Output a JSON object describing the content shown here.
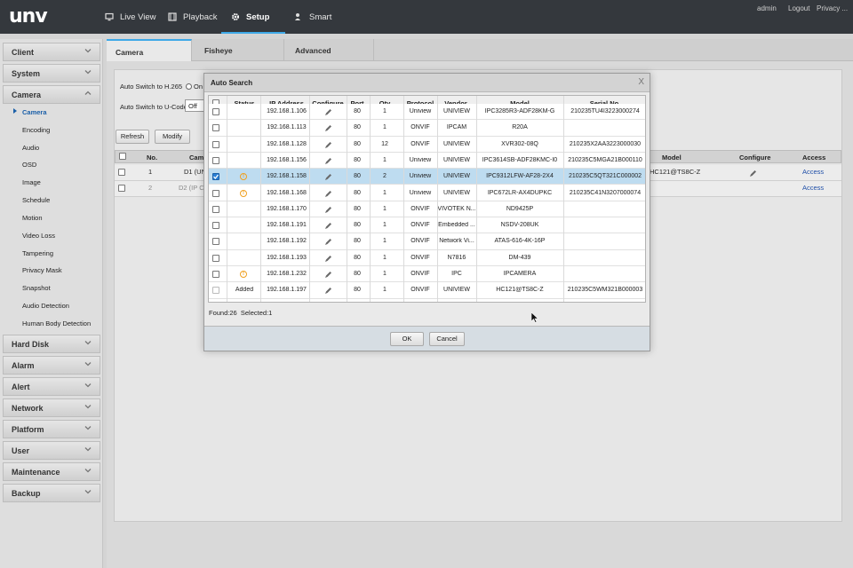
{
  "app": {
    "logo": "unv",
    "nav": [
      "Live View",
      "Playback",
      "Setup",
      "Smart"
    ],
    "user": "admin",
    "logout": "Logout",
    "privacy": "Privacy ..."
  },
  "sidebar": {
    "sections": [
      "Client",
      "System",
      "Camera",
      "Hard Disk",
      "Alarm",
      "Alert",
      "Network",
      "Platform",
      "User",
      "Maintenance",
      "Backup"
    ],
    "camera_items": [
      "Camera",
      "Encoding",
      "Audio",
      "OSD",
      "Image",
      "Schedule",
      "Motion",
      "Video Loss",
      "Tampering",
      "Privacy Mask",
      "Snapshot",
      "Audio Detection",
      "Human Body Detection"
    ]
  },
  "tabs": [
    "Camera",
    "Fisheye",
    "Advanced"
  ],
  "panel": {
    "h265_label": "Auto Switch to H.265",
    "h265_on": "On",
    "ucode_label": "Auto Switch to U-Code",
    "ucode_value": "Off",
    "refresh": "Refresh",
    "modify": "Modify",
    "table_headers": {
      "no": "No.",
      "camera": "Came",
      "model": "Model",
      "configure": "Configure",
      "access": "Access"
    },
    "rows": [
      {
        "no": "1",
        "camera": "D1 (UN",
        "model": "HC121@TS8C-Z",
        "access": "Access"
      },
      {
        "no": "2",
        "camera": "D2 (IP Ca",
        "model": "",
        "access": "Access"
      }
    ]
  },
  "modal": {
    "title": "Auto Search",
    "close": "X",
    "headers": [
      "Status",
      "IP Address",
      "Configure",
      "Port",
      "Qty",
      "Protocol",
      "Vendor",
      "Model",
      "Serial No."
    ],
    "rows": [
      {
        "status": "",
        "ip": "192.168.1.106",
        "port": "80",
        "qty": "1",
        "protocol": "Uniview",
        "vendor": "UNIVIEW",
        "model": "IPC3285R3-ADF28KM-G",
        "serial": "210235TU4I3223000274"
      },
      {
        "status": "",
        "ip": "192.168.1.113",
        "port": "80",
        "qty": "1",
        "protocol": "ONVIF",
        "vendor": "IPCAM",
        "model": "R20A",
        "serial": ""
      },
      {
        "status": "",
        "ip": "192.168.1.128",
        "port": "80",
        "qty": "12",
        "protocol": "ONVIF",
        "vendor": "UNIVIEW",
        "model": "XVR302-08Q",
        "serial": "210235X2AA3223000030"
      },
      {
        "status": "",
        "ip": "192.168.1.156",
        "port": "80",
        "qty": "1",
        "protocol": "Uniview",
        "vendor": "UNIVIEW",
        "model": "IPC3614SB-ADF28KMC-I0",
        "serial": "210235C5MGA21B000110"
      },
      {
        "status": "warn",
        "ip": "192.168.1.158",
        "port": "80",
        "qty": "2",
        "protocol": "Uniview",
        "vendor": "UNIVIEW",
        "model": "IPC9312LFW-AF28-2X4",
        "serial": "210235C5QT321C000002"
      },
      {
        "status": "warn",
        "ip": "192.168.1.168",
        "port": "80",
        "qty": "1",
        "protocol": "Uniview",
        "vendor": "UNIVIEW",
        "model": "IPC672LR-AX4DUPKC",
        "serial": "210235C41N3207000074"
      },
      {
        "status": "",
        "ip": "192.168.1.170",
        "port": "80",
        "qty": "1",
        "protocol": "ONVIF",
        "vendor": "VIVOTEK N...",
        "model": "ND9425P",
        "serial": ""
      },
      {
        "status": "",
        "ip": "192.168.1.191",
        "port": "80",
        "qty": "1",
        "protocol": "ONVIF",
        "vendor": "Embedded ...",
        "model": "NSDV-208UK",
        "serial": ""
      },
      {
        "status": "",
        "ip": "192.168.1.192",
        "port": "80",
        "qty": "1",
        "protocol": "ONVIF",
        "vendor": "Network Vi...",
        "model": "ATAS-616-4K-16P",
        "serial": ""
      },
      {
        "status": "",
        "ip": "192.168.1.193",
        "port": "80",
        "qty": "1",
        "protocol": "ONVIF",
        "vendor": "N7816",
        "model": "DM-439",
        "serial": ""
      },
      {
        "status": "warn",
        "ip": "192.168.1.232",
        "port": "80",
        "qty": "1",
        "protocol": "ONVIF",
        "vendor": "IPC",
        "model": "IPCAMERA",
        "serial": ""
      },
      {
        "status": "Added",
        "ip": "192.168.1.197",
        "port": "80",
        "qty": "1",
        "protocol": "ONVIF",
        "vendor": "UNIVIEW",
        "model": "HC121@TS8C-Z",
        "serial": "210235C5WM321B000003"
      }
    ],
    "selected_index": 4,
    "found_label": "Found:26",
    "selected_label": "Selected:1",
    "ok": "OK",
    "cancel": "Cancel"
  },
  "colors": {
    "accent": "#3fa9e8",
    "selected_row": "#bedcf0",
    "topbar": "#34383d",
    "warning": "#f0a020"
  }
}
